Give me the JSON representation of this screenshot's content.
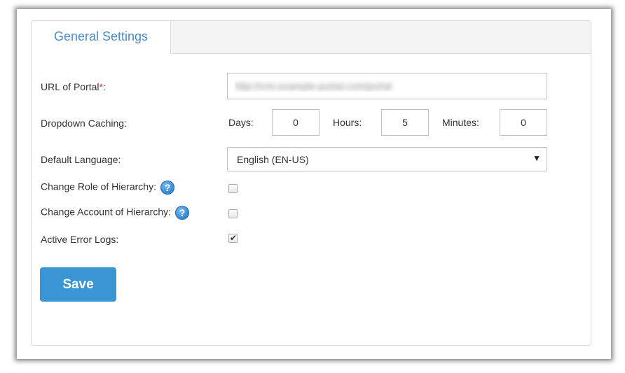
{
  "tab": {
    "label": "General Settings"
  },
  "fields": {
    "url_portal": {
      "label": "URL of Portal",
      "required_mark": "*:",
      "value": "http://crm.example-portal.com/portal"
    },
    "dropdown_caching": {
      "label": "Dropdown Caching:",
      "days_label": "Days:",
      "days_value": "0",
      "hours_label": "Hours:",
      "hours_value": "5",
      "minutes_label": "Minutes:",
      "minutes_value": "0"
    },
    "default_language": {
      "label": "Default Language:",
      "selected": "English (EN-US)"
    },
    "change_role": {
      "label": "Change Role of Hierarchy:",
      "checked": false
    },
    "change_account": {
      "label": "Change Account of Hierarchy:",
      "checked": false
    },
    "active_error_logs": {
      "label": "Active Error Logs:",
      "checked": true
    }
  },
  "actions": {
    "save_label": "Save"
  },
  "icons": {
    "help": "help-question-icon",
    "caret": "caret-down-icon",
    "check": "checkmark-icon"
  },
  "colors": {
    "accent": "#3a95d4",
    "tab_text": "#4a8cc8",
    "required": "#e03030"
  }
}
